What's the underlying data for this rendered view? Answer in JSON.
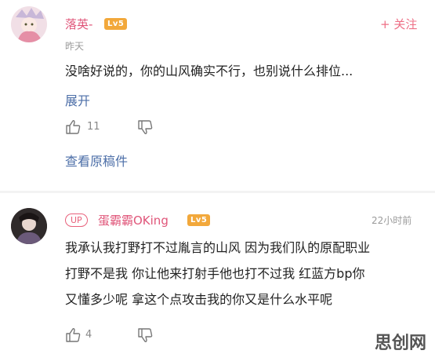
{
  "comment1": {
    "username": "落英-",
    "level": "Lv5",
    "follow_label": "+ 关注",
    "time": "昨天",
    "text": "没啥好说的，你的山风确实不行，也别说什么排位...",
    "expand_label": "展开",
    "likes": "11",
    "view_original_label": "查看原稿件"
  },
  "comment2": {
    "up_tag": "UP",
    "username": "蛋霸霸OKing",
    "level": "Lv5",
    "time": "22小时前",
    "lines": [
      "我承认我打野打不过胤言的山风 因为我们队的原配职业",
      "打野不是我 你让他来打射手他也打不过我  红蓝方bp你",
      "又懂多少呢 拿这个点攻击我的你又是什么水平呢"
    ],
    "likes": "4"
  },
  "watermark": "思创网",
  "colors": {
    "accent": "#e0567a",
    "link": "#4d6fa8",
    "level_badge": "#f2a83b"
  }
}
